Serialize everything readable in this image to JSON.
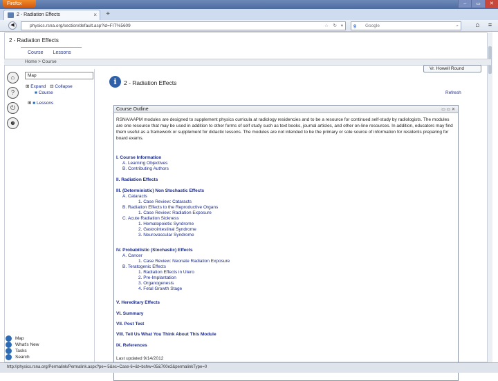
{
  "browser": {
    "app_button": "Firefox",
    "tab_title": "2 - Radiation Effects",
    "new_tab": "+",
    "url": "physics.rsna.org/section/default.asp?id=FIT%5609",
    "search_placeholder": "Google",
    "search_engine_letter": "g"
  },
  "app": {
    "title": "2 - Radiation Effects",
    "nav": [
      "Course",
      "Lessons"
    ],
    "breadcrumb": "Home > Course",
    "user_button": "Vr. Howell Round"
  },
  "sidebar": {
    "map_value": "Map",
    "expand_label": "Expand",
    "collapse_label": "Collapse",
    "tree_course": "Course",
    "tree_lessons": "Lessons",
    "bottom_links": [
      "Map",
      "What's New",
      "Tasks",
      "Search"
    ]
  },
  "main": {
    "title": "2 - Radiation Effects",
    "refresh_label": "Refresh",
    "outline_header": "Course Outline",
    "intro": "RSNA/AAPM modules are designed to supplement physics curricula at radiology residencies and to be a resource for continued self-study by radiologists. The modules are one resource that may be used in addition to other forms of self study such as text books, journal articles, and other on-line resources. In addition, educators may find them useful as a framework or supplement for didactic lessons. The modules are not intended to be the primary or sole source of information for residents preparing for board exams.",
    "outline": [
      {
        "text": "I. Course Information",
        "level": 1
      },
      {
        "text": "A. Learning Objectives",
        "level": 2
      },
      {
        "text": "B. Contributing Authors",
        "level": 2
      },
      {
        "text": "II. Radiation Effects",
        "level": 1
      },
      {
        "text": "III. (Deterministic) Non Stochastic Effects",
        "level": 1
      },
      {
        "text": "A. Cataracts",
        "level": 2
      },
      {
        "text": "1. Case Review: Cataracts",
        "level": 3
      },
      {
        "text": "B. Radiation Effects to the Reproductive Organs",
        "level": 2
      },
      {
        "text": "1. Case Review: Radiation Exposure",
        "level": 3
      },
      {
        "text": "C. Acute Radiation Sickness",
        "level": 2
      },
      {
        "text": "1. Hematopoietic Syndrome",
        "level": 3
      },
      {
        "text": "2. Gastrointestinal Syndrome",
        "level": 3
      },
      {
        "text": "3. Neurovascular Syndrome",
        "level": 3
      },
      {
        "text": "IV. Probabilistic (Stochastic) Effects",
        "level": 1
      },
      {
        "text": "A. Cancer",
        "level": 2
      },
      {
        "text": "1. Case Review: Neonate Radiation Exposure",
        "level": 3
      },
      {
        "text": "B. Teratogenic Effects",
        "level": 2
      },
      {
        "text": "1. Radiation Effects in Utero",
        "level": 3
      },
      {
        "text": "2. Pre-Implantation",
        "level": 3
      },
      {
        "text": "3. Organogenesis",
        "level": 3
      },
      {
        "text": "4. Fetal Growth Stage",
        "level": 3
      },
      {
        "text": "V. Hereditary Effects",
        "level": 1
      },
      {
        "text": "VI. Summary",
        "level": 1
      },
      {
        "text": "VII. Post Test",
        "level": 1
      },
      {
        "text": "VIII. Tell Us What You Think About This Module",
        "level": 1
      },
      {
        "text": "IX. References",
        "level": 1
      }
    ],
    "updated": "Last updated 9/14/2012"
  },
  "status_bar": "http://physics.rsna.org/Permalink/Permalink.aspx?pe=-5&ec=Case-6=&t=bshw=05&700e2&permalinkType=0"
}
